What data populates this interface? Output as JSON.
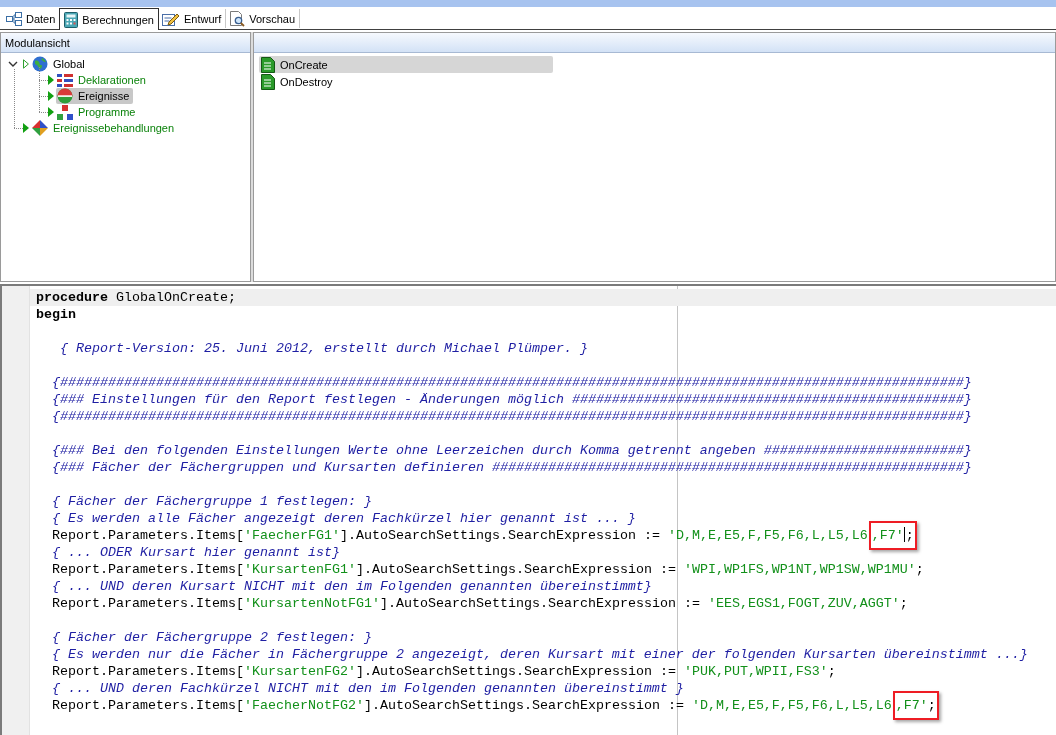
{
  "tabs": [
    {
      "label": "Daten",
      "kind": "data",
      "selected": false
    },
    {
      "label": "Berechnungen",
      "kind": "calc",
      "selected": true
    },
    {
      "label": "Entwurf",
      "kind": "design",
      "selected": false
    },
    {
      "label": "Vorschau",
      "kind": "preview",
      "selected": false
    }
  ],
  "module_view": {
    "title": "Modulansicht",
    "tree": [
      {
        "label": "Global",
        "kind": "module",
        "expanded": true,
        "selected": false,
        "children": [
          {
            "label": "Deklarationen",
            "kind": "declarations",
            "expanded": false,
            "selected": false
          },
          {
            "label": "Ereignisse",
            "kind": "events",
            "expanded": false,
            "selected": true
          },
          {
            "label": "Programme",
            "kind": "programs",
            "expanded": false,
            "selected": false
          }
        ]
      },
      {
        "label": "Ereignissebehandlungen",
        "kind": "handlers",
        "expanded": false,
        "selected": false
      }
    ]
  },
  "event_list": {
    "items": [
      {
        "label": "OnCreate",
        "selected": true
      },
      {
        "label": "OnDestroy",
        "selected": false
      }
    ]
  },
  "editor": {
    "lines": [
      {
        "kind": "code",
        "highlighted": true,
        "segments": [
          {
            "kind": "keyword",
            "text": "procedure"
          },
          {
            "kind": "plain",
            "text": " GlobalOnCreate;"
          }
        ]
      },
      {
        "kind": "code",
        "highlighted": false,
        "segments": [
          {
            "kind": "keyword",
            "text": "begin"
          }
        ]
      },
      {
        "kind": "blank",
        "highlighted": false
      },
      {
        "kind": "code",
        "highlighted": false,
        "segments": [
          {
            "kind": "comment",
            "text": "   { Report-Version: 25. Juni 2012, erstellt durch Michael Plümper. }"
          }
        ]
      },
      {
        "kind": "blank",
        "highlighted": false
      },
      {
        "kind": "code",
        "highlighted": false,
        "segments": [
          {
            "kind": "comment",
            "text": "  {#################################################################################################################}"
          }
        ]
      },
      {
        "kind": "code",
        "highlighted": false,
        "segments": [
          {
            "kind": "comment",
            "text": "  {### Einstellungen für den Report festlegen - Änderungen möglich #################################################}"
          }
        ]
      },
      {
        "kind": "code",
        "highlighted": false,
        "segments": [
          {
            "kind": "comment",
            "text": "  {#################################################################################################################}"
          }
        ]
      },
      {
        "kind": "blank",
        "highlighted": false
      },
      {
        "kind": "code",
        "highlighted": false,
        "segments": [
          {
            "kind": "comment",
            "text": "  {### Bei den folgenden Einstellungen Werte ohne Leerzeichen durch Komma getrennt angeben #########################}"
          }
        ]
      },
      {
        "kind": "code",
        "highlighted": false,
        "segments": [
          {
            "kind": "comment",
            "text": "  {### Fächer der Fächergruppen und Kursarten definieren ###########################################################}"
          }
        ]
      },
      {
        "kind": "blank",
        "highlighted": false
      },
      {
        "kind": "code",
        "highlighted": false,
        "segments": [
          {
            "kind": "comment",
            "text": "  { Fächer der Fächergruppe 1 festlegen: }"
          }
        ]
      },
      {
        "kind": "code",
        "highlighted": false,
        "segments": [
          {
            "kind": "comment",
            "text": "  { Es werden alle Fächer angezeigt deren Fachkürzel hier genannt ist ... }"
          }
        ]
      },
      {
        "kind": "code",
        "highlighted": false,
        "segments": [
          {
            "kind": "plain",
            "text": "  Report.Parameters.Items["
          },
          {
            "kind": "string",
            "text": "'FaecherFG1'"
          },
          {
            "kind": "plain",
            "text": "].AutoSearchSettings.SearchExpression := "
          },
          {
            "kind": "string",
            "text": "'D,M,E,E5,F,F5,F6,L,L5,L6"
          },
          {
            "kind": "callout",
            "segments": [
              {
                "kind": "string",
                "text": ",F7'"
              },
              {
                "kind": "cursor"
              },
              {
                "kind": "plain",
                "text": ";"
              }
            ]
          }
        ]
      },
      {
        "kind": "code",
        "highlighted": false,
        "segments": [
          {
            "kind": "comment",
            "text": "  { ... ODER Kursart hier genannt ist}"
          }
        ]
      },
      {
        "kind": "code",
        "highlighted": false,
        "segments": [
          {
            "kind": "plain",
            "text": "  Report.Parameters.Items["
          },
          {
            "kind": "string",
            "text": "'KursartenFG1'"
          },
          {
            "kind": "plain",
            "text": "].AutoSearchSettings.SearchExpression := "
          },
          {
            "kind": "string",
            "text": "'WPI,WP1FS,WP1NT,WP1SW,WP1MU'"
          },
          {
            "kind": "plain",
            "text": ";"
          }
        ]
      },
      {
        "kind": "code",
        "highlighted": false,
        "segments": [
          {
            "kind": "comment",
            "text": "  { ... UND deren Kursart NICHT mit den im Folgenden genannten übereinstimmt}"
          }
        ]
      },
      {
        "kind": "code",
        "highlighted": false,
        "segments": [
          {
            "kind": "plain",
            "text": "  Report.Parameters.Items["
          },
          {
            "kind": "string",
            "text": "'KursartenNotFG1'"
          },
          {
            "kind": "plain",
            "text": "].AutoSearchSettings.SearchExpression := "
          },
          {
            "kind": "string",
            "text": "'EES,EGS1,FOGT,ZUV,AGGT'"
          },
          {
            "kind": "plain",
            "text": ";"
          }
        ]
      },
      {
        "kind": "blank",
        "highlighted": false
      },
      {
        "kind": "code",
        "highlighted": false,
        "segments": [
          {
            "kind": "comment",
            "text": "  { Fächer der Fächergruppe 2 festlegen: }"
          }
        ]
      },
      {
        "kind": "code",
        "highlighted": false,
        "segments": [
          {
            "kind": "comment",
            "text": "  { Es werden nur die Fächer in Fächergruppe 2 angezeigt, deren Kursart mit einer der folgenden Kursarten übereinstimmt ...}"
          }
        ]
      },
      {
        "kind": "code",
        "highlighted": false,
        "segments": [
          {
            "kind": "plain",
            "text": "  Report.Parameters.Items["
          },
          {
            "kind": "string",
            "text": "'KursartenFG2'"
          },
          {
            "kind": "plain",
            "text": "].AutoSearchSettings.SearchExpression := "
          },
          {
            "kind": "string",
            "text": "'PUK,PUT,WPII,FS3'"
          },
          {
            "kind": "plain",
            "text": ";"
          }
        ]
      },
      {
        "kind": "code",
        "highlighted": false,
        "segments": [
          {
            "kind": "comment",
            "text": "  { ... UND deren Fachkürzel NICHT mit den im Folgenden genannten übereinstimmt }"
          }
        ]
      },
      {
        "kind": "code",
        "highlighted": false,
        "segments": [
          {
            "kind": "plain",
            "text": "  Report.Parameters.Items["
          },
          {
            "kind": "string",
            "text": "'FaecherNotFG2'"
          },
          {
            "kind": "plain",
            "text": "].AutoSearchSettings.SearchExpression := "
          },
          {
            "kind": "string",
            "text": "'D,M,E,E5,F,F5,F6,L,L5,L6"
          },
          {
            "kind": "callout",
            "segments": [
              {
                "kind": "string",
                "text": ",F7'"
              },
              {
                "kind": "plain",
                "text": ";"
              }
            ]
          }
        ]
      }
    ]
  }
}
